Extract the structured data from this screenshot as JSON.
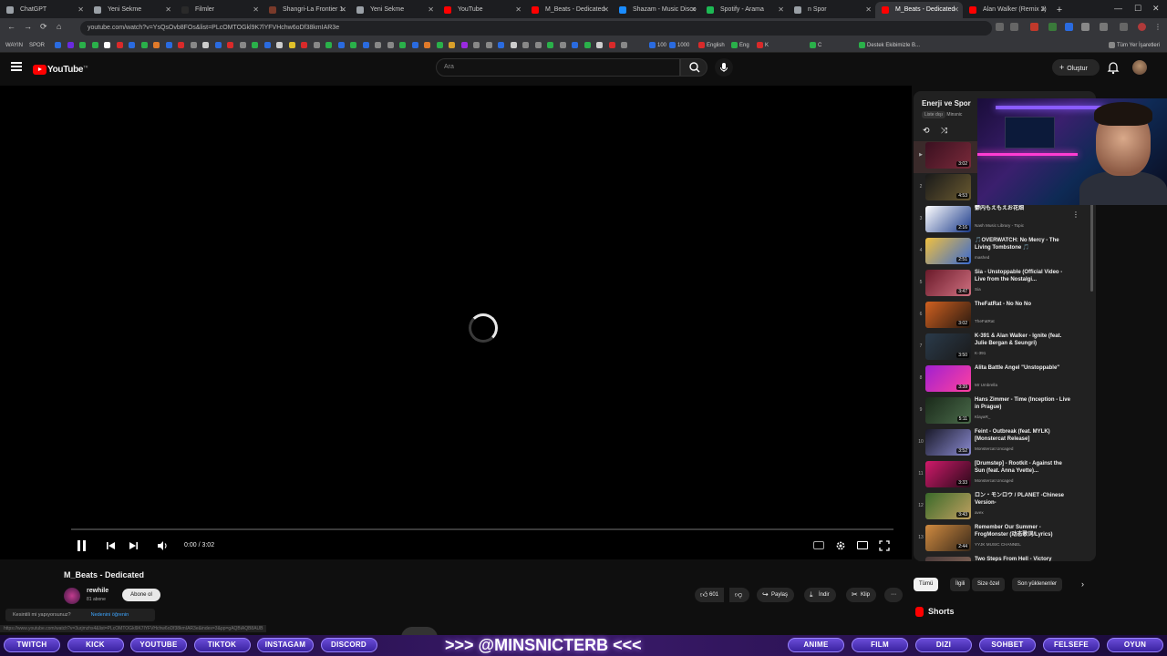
{
  "browser": {
    "tabs": [
      {
        "label": "ChatGPT",
        "favicon_color": "#9aa0a6"
      },
      {
        "label": "Yeni Sekme",
        "favicon_color": "#9aa0a6"
      },
      {
        "label": "Filmler",
        "favicon_color": "#2a2a2a"
      },
      {
        "label": "Shangri-La Frontier 1.",
        "favicon_color": "#7a3a2a"
      },
      {
        "label": "Yeni Sekme",
        "favicon_color": "#9aa0a6"
      },
      {
        "label": "YouTube",
        "favicon_color": "#ff0000"
      },
      {
        "label": "M_Beats - Dedicated",
        "favicon_color": "#ff0000"
      },
      {
        "label": "Shazam - Music Disco",
        "favicon_color": "#1a8cff"
      },
      {
        "label": "Spotify - Arama",
        "favicon_color": "#1db954"
      },
      {
        "label": "n Spor",
        "favicon_color": "#9aa0a6"
      },
      {
        "label": "M_Beats - Dedicated",
        "favicon_color": "#ff0000",
        "active": true
      },
      {
        "label": "Alan Walker (Remix 2)",
        "favicon_color": "#ff0000"
      }
    ],
    "url": "youtube.com/watch?v=YsQsOvb8FOs&list=PLcOMTOGkl9K7lYFVHchw6oDf38kmIAR3e",
    "bookmarks": [
      {
        "label": "WAYIN",
        "color": "#555"
      },
      {
        "label": "SPOR",
        "color": "#555"
      },
      {
        "label": "",
        "color": "#888"
      },
      {
        "label": "100",
        "color": "#2a6be0"
      },
      {
        "label": "1000",
        "color": "#2a6be0"
      },
      {
        "label": "English",
        "color": "#d92a2a"
      },
      {
        "label": "Eng",
        "color": "#2ab04a"
      },
      {
        "label": "K",
        "color": "#d92a2a"
      },
      {
        "label": "C",
        "color": "#2ab04a"
      },
      {
        "label": "Destek Ekibimizle B...",
        "color": "#2ab04a"
      },
      {
        "label": "Tüm Yer İşaretleri",
        "color": "#888"
      }
    ]
  },
  "header": {
    "logo_text": "YouTube",
    "logo_super": "TR",
    "search_placeholder": "Ara",
    "create_label": "Oluştur"
  },
  "player": {
    "time": "0:00 / 3:02",
    "progress": 0.0,
    "loading": true
  },
  "video": {
    "title": "M_Beats - Dedicated",
    "channel": "rewhile",
    "subscribers": "81 abone",
    "subscribe_label": "Abone ol",
    "likes": "601",
    "share_label": "Paylaş",
    "download_label": "İndir",
    "clip_label": "Klip"
  },
  "popup": {
    "question": "Kesintili mi yapıyorsunuz?",
    "link": "Nedenini öğrenin"
  },
  "status_url": "https://www.youtube.com/watch?v=3urjmzhs4&list=PLcOMTOGkl9K7lYFVHchw6oDf38kmIAR3e&index=3&pp=gAQBiAQB8AUB",
  "playlist": {
    "title": "Enerji ve Spor",
    "sub_chip": "Liste dışı",
    "sub_author": "Minsnic",
    "items": [
      {
        "num": "▶",
        "title": "",
        "channel": "",
        "duration": "3:02",
        "thumb": [
          "#3a1020",
          "#7a2a3a"
        ],
        "active": true
      },
      {
        "num": "2",
        "title": "",
        "channel": "",
        "duration": "4:53",
        "thumb": [
          "#1a1a1a",
          "#6a5a30"
        ]
      },
      {
        "num": "3",
        "title": "鬱内もえもえお花畑",
        "channel": "Nash Music Library - Topic",
        "duration": "2:16",
        "thumb": [
          "#ffffff",
          "#1a3a8a"
        ]
      },
      {
        "num": "4",
        "title": "🎵OVERWATCH: No Mercy - The Living Tombstone 🎵",
        "channel": "mashed",
        "duration": "2:51",
        "thumb": [
          "#f0c040",
          "#3a6ad0"
        ]
      },
      {
        "num": "5",
        "title": "Sia - Unstoppable (Official Video - Live from the Nostalgi...",
        "channel": "Sia",
        "duration": "3:47",
        "thumb": [
          "#6a1a2a",
          "#d07080"
        ]
      },
      {
        "num": "6",
        "title": "TheFatRat - No No No",
        "channel": "TheFatRat",
        "duration": "3:02",
        "thumb": [
          "#d06020",
          "#2a1a10"
        ]
      },
      {
        "num": "7",
        "title": "K-391 & Alan Walker - Ignite (feat. Julie Bergan & Seungri)",
        "channel": "K-391",
        "duration": "3:50",
        "thumb": [
          "#2a3a4a",
          "#1a1a1a"
        ]
      },
      {
        "num": "8",
        "title": "Alita Battle Angel \"Unstoppable\"",
        "channel": "Mr Umbrella",
        "duration": "3:39",
        "thumb": [
          "#a020d0",
          "#ff40a0"
        ]
      },
      {
        "num": "9",
        "title": "Hans Zimmer - Time (Inception - Live in Prague)",
        "channel": "KlayaR_",
        "duration": "5:11",
        "thumb": [
          "#1a2a1a",
          "#4a6a4a"
        ]
      },
      {
        "num": "10",
        "title": "Feint - Outbreak (feat. MYLK) [Monstercat Release]",
        "channel": "Monstercat Uncaged",
        "duration": "3:52",
        "thumb": [
          "#1a1a2a",
          "#8a8ad0"
        ]
      },
      {
        "num": "11",
        "title": "[Drumstep] - Rootkit - Against the Sun (feat. Anna Yvette)...",
        "channel": "Monstercat Uncaged",
        "duration": "3:33",
        "thumb": [
          "#d01a6a",
          "#2a0a1a"
        ]
      },
      {
        "num": "12",
        "title": "ロン・モンロウ / PLANET -Chinese Version-",
        "channel": "avex",
        "duration": "3:43",
        "thumb": [
          "#3a6a2a",
          "#c0a060"
        ]
      },
      {
        "num": "13",
        "title": "Remember Our Summer - FrogMonster (动态歌词/Lyrics)",
        "channel": "YYJK MUSIC CHANNEL",
        "duration": "2:44",
        "thumb": [
          "#d08a40",
          "#3a2a1a"
        ]
      },
      {
        "num": "14",
        "title": "Two Steps From Hell - Victory",
        "channel": "",
        "duration": "",
        "thumb": [
          "#4a3a3a",
          "#8a6a5a"
        ]
      }
    ]
  },
  "chips": [
    "Tümü",
    "İlgili",
    "Size özel",
    "Son yüklenenler"
  ],
  "shorts_label": "Shorts",
  "overlay": {
    "left_buttons": [
      "TWITCH",
      "KICK",
      "YOUTUBE",
      "TIKTOK",
      "INSTAGAM",
      "DISCORD"
    ],
    "handle": ">>> @MINSNICTERB <<<",
    "right_buttons": [
      "ANIME",
      "FILM",
      "DIZI",
      "SOHBET",
      "FELSEFE",
      "OYUN"
    ]
  }
}
